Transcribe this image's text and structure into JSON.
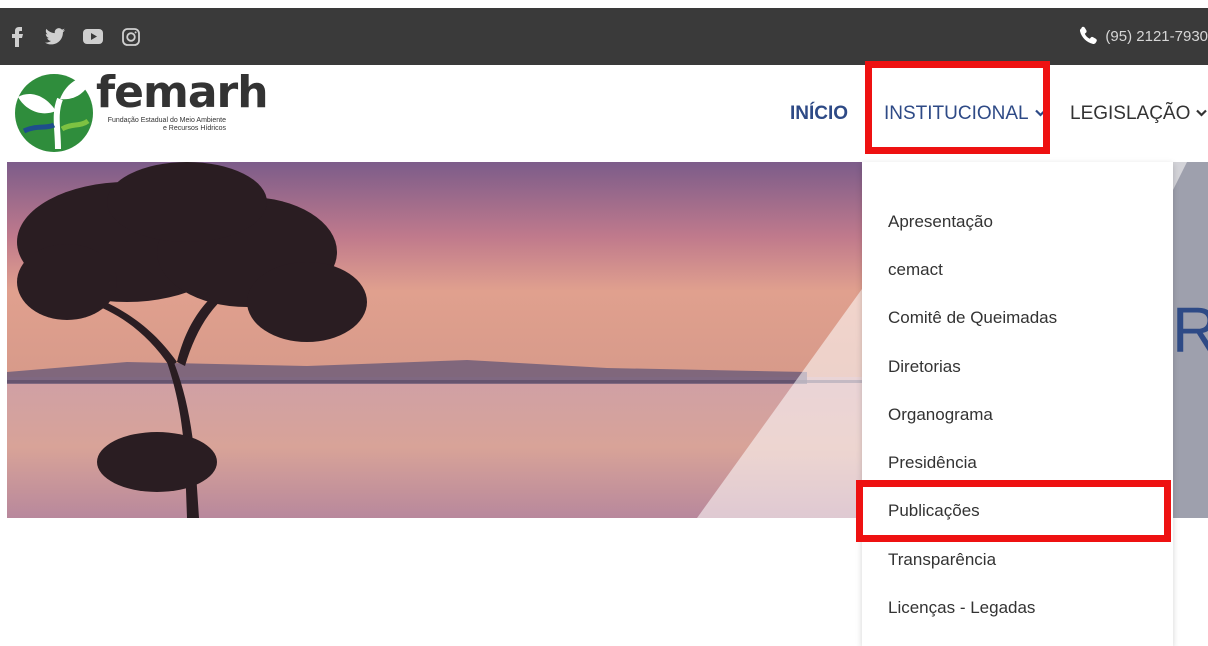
{
  "topbar": {
    "social_icons": [
      "facebook-icon",
      "twitter-icon",
      "youtube-icon",
      "instagram-icon"
    ],
    "phone_icon": "phone-icon",
    "phone": "(95) 2121-7930"
  },
  "logo": {
    "name": "femarh",
    "subtitle_line1": "Fundação Estadual do Meio Ambiente",
    "subtitle_line2": "e Recursos Hídricos"
  },
  "nav": {
    "inicio": "INÍCIO",
    "institucional": "INSTITUCIONAL",
    "legislacao": "LEGISLAÇÃO"
  },
  "dropdown": {
    "items": [
      "Apresentação",
      "cemact",
      "Comitê de Queimadas",
      "Diretorias",
      "Organograma",
      "Presidência",
      "Publicações",
      "Transparência",
      "Licenças - Legadas"
    ]
  },
  "hero": {
    "partial_text": "Re"
  },
  "colors": {
    "topbar": "#3a3a3a",
    "nav_active": "#2e4a86",
    "highlight": "#ee1111"
  }
}
